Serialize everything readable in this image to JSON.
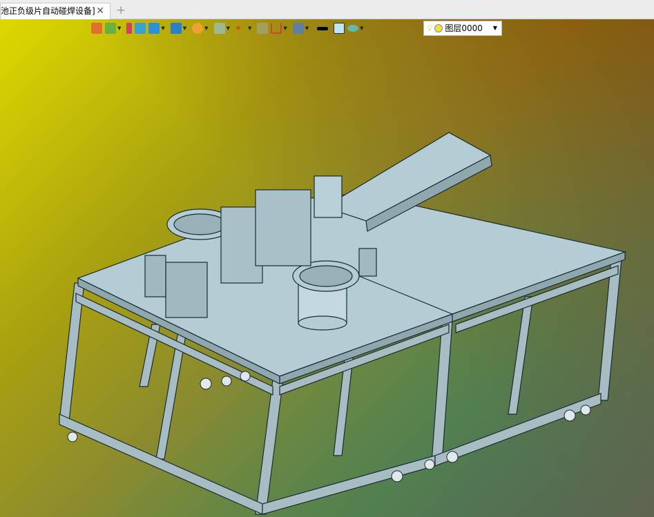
{
  "tab": {
    "title": "池正负级片自动碰焊设备]",
    "close_icon": "close-icon",
    "add_icon": "plus-icon"
  },
  "toolbar": {
    "icons": [
      "exit-sketch-icon",
      "sketch-color-icon",
      "brush-icon",
      "extrude-box-icon",
      "solid-cube-icon",
      "view-cube-icon",
      "render-style-icon",
      "section-view-icon",
      "coordinate-axis-icon",
      "image-icon",
      "dimension-icon",
      "display-monitor-icon",
      "line-weight-icon",
      "fill-color-icon",
      "layer-stack-icon"
    ],
    "layer_select": {
      "value": "图层0000",
      "icons": [
        "lightbulb-icon",
        "sun-icon"
      ]
    }
  },
  "colors": {
    "bg_top_left": "#ddd800",
    "bg_top_right": "#8a5808",
    "bg_bottom_left": "#2e8a60",
    "bg_bottom_right": "#5e6450",
    "model": "#b8d4dc",
    "model_edge": "#1a2a30"
  }
}
